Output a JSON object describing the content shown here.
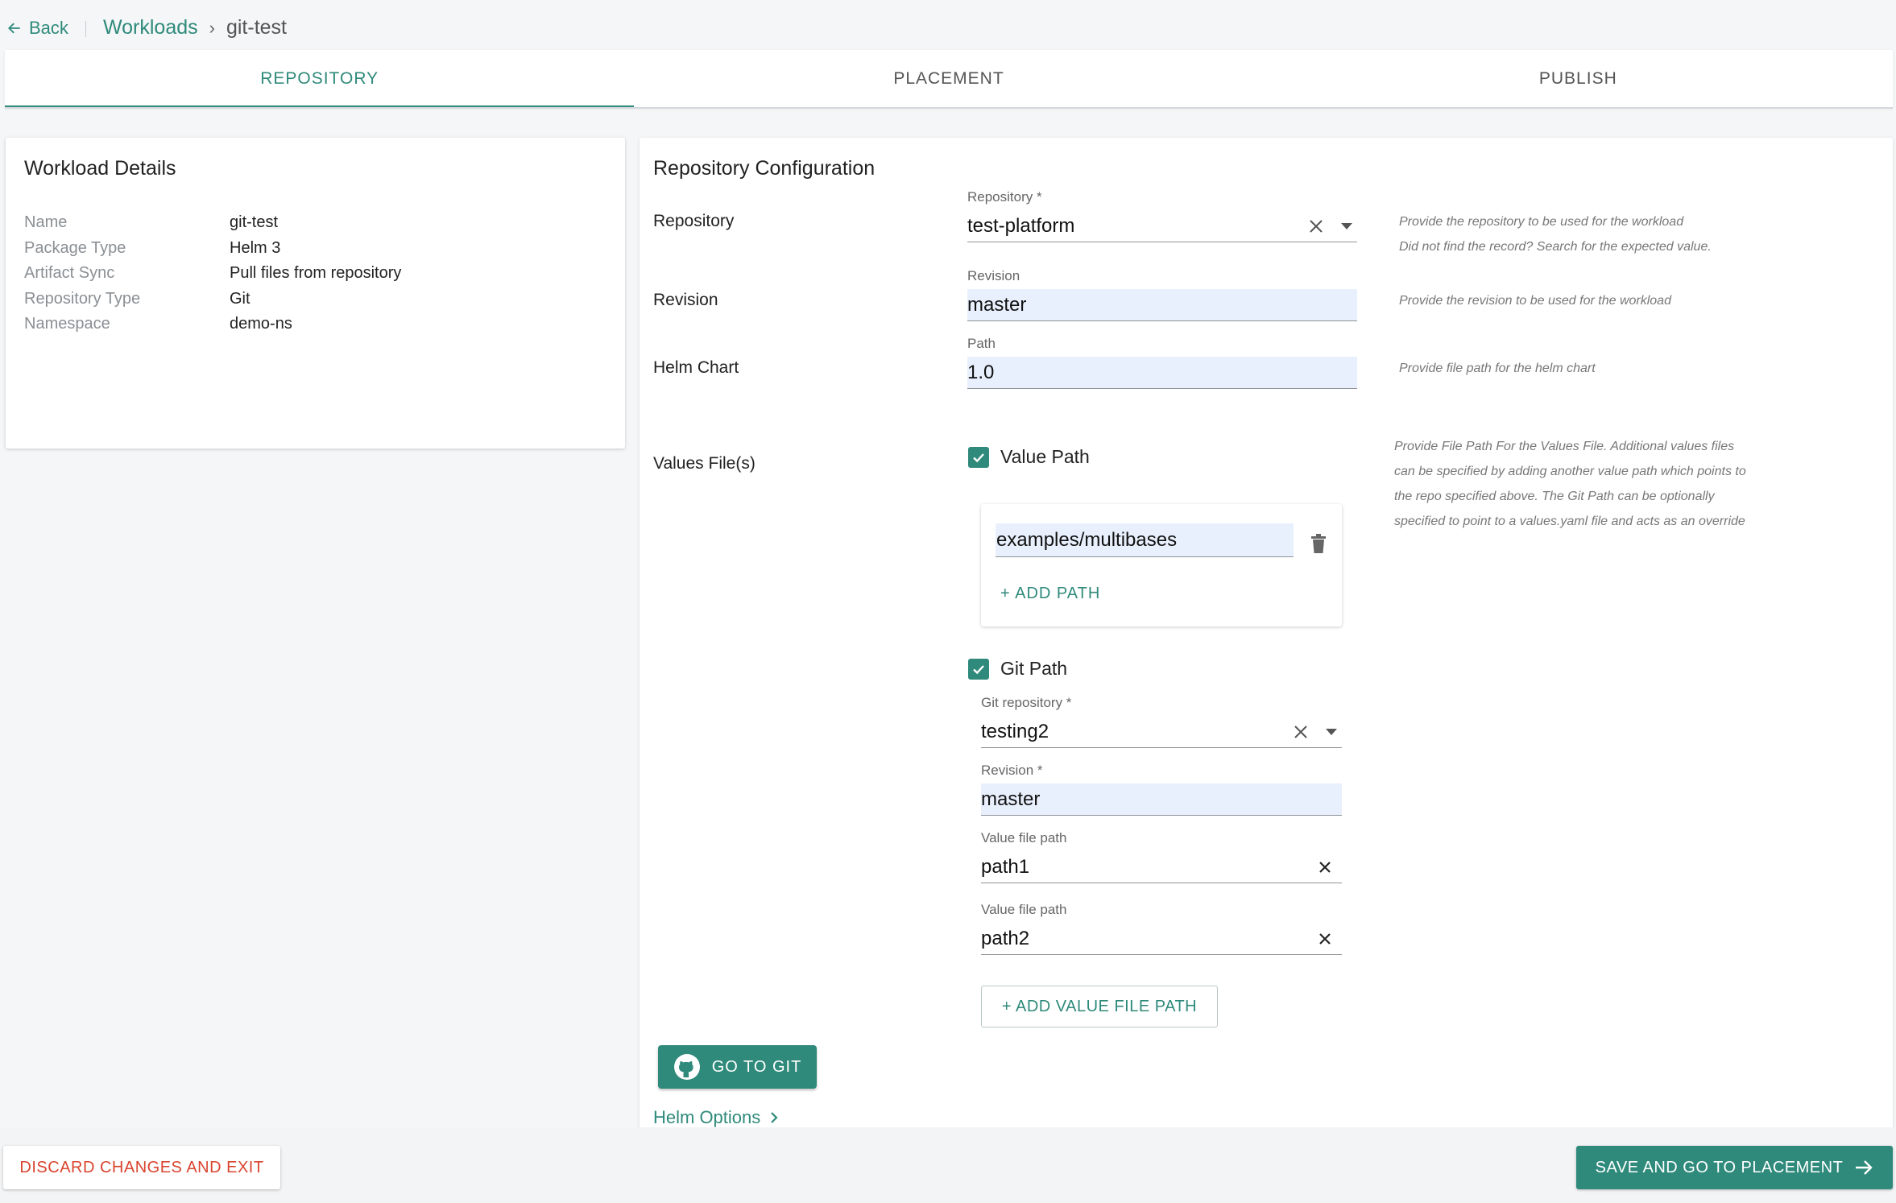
{
  "header": {
    "back_label": "Back",
    "breadcrumb": {
      "parent": "Workloads",
      "current": "git-test"
    }
  },
  "tabs": [
    {
      "label": "REPOSITORY",
      "active": true
    },
    {
      "label": "PLACEMENT",
      "active": false
    },
    {
      "label": "PUBLISH",
      "active": false
    }
  ],
  "workload_details": {
    "title": "Workload Details",
    "rows": [
      {
        "key": "Name",
        "value": "git-test"
      },
      {
        "key": "Package Type",
        "value": "Helm 3"
      },
      {
        "key": "Artifact Sync",
        "value": "Pull files from repository"
      },
      {
        "key": "Repository Type",
        "value": "Git"
      },
      {
        "key": "Namespace",
        "value": "demo-ns"
      }
    ]
  },
  "repo_config": {
    "title": "Repository Configuration",
    "repository": {
      "row_label": "Repository",
      "field_label": "Repository *",
      "value": "test-platform",
      "help_1": "Provide the repository to be used for the workload",
      "help_2": "Did not find the record? Search for the expected value."
    },
    "revision": {
      "row_label": "Revision",
      "field_label": "Revision",
      "value": "master",
      "help": "Provide the revision to be used for the workload"
    },
    "helm_chart": {
      "row_label": "Helm Chart",
      "field_label": "Path",
      "value": "1.0",
      "help": "Provide file path for the helm chart"
    },
    "values_files": {
      "row_label": "Values File(s)",
      "help_lines": [
        "Provide File Path For the Values File. Additional values files",
        "can be specified by adding another value path which points to",
        "the repo specified above. The Git Path can be optionally",
        "specified to point to a values.yaml file and acts as an override"
      ],
      "value_path": {
        "label": "Value Path",
        "checked": true,
        "paths": [
          "examples/multibases"
        ],
        "add_label": "+ ADD  PATH"
      },
      "git_path": {
        "label": "Git Path",
        "checked": true,
        "git_repo_label": "Git repository *",
        "git_repo_value": "testing2",
        "revision_label": "Revision *",
        "revision_value": "master",
        "value_file_paths": [
          {
            "label": "Value file path",
            "value": "path1"
          },
          {
            "label": "Value file path",
            "value": "path2"
          }
        ],
        "add_label": "+ ADD VALUE FILE PATH"
      }
    },
    "go_to_git_label": "GO TO GIT",
    "helm_options_label": "Helm Options"
  },
  "footer": {
    "discard_label": "DISCARD CHANGES AND EXIT",
    "save_label": "SAVE AND GO TO PLACEMENT"
  },
  "colors": {
    "accent": "#2f8a7b",
    "danger": "#d9452f",
    "filled_input": "#e9f0fd"
  }
}
